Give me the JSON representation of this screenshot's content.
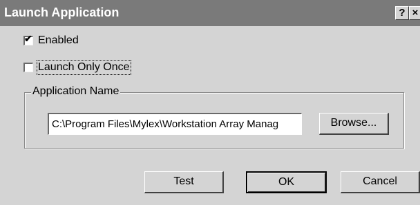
{
  "window": {
    "title": "Launch Application",
    "help_glyph": "?",
    "close_glyph": "×"
  },
  "options": {
    "enabled_label": "Enabled",
    "enabled_checked": true,
    "checkmark_glyph": "✔",
    "launch_once_label": "Launch Only Once",
    "launch_once_checked": false
  },
  "app_group": {
    "legend": "Application Name",
    "path_value": "C:\\Program Files\\Mylex\\Workstation Array Manag",
    "browse_label": "Browse..."
  },
  "buttons": {
    "test_label": "Test",
    "ok_label": "OK",
    "cancel_label": "Cancel"
  }
}
